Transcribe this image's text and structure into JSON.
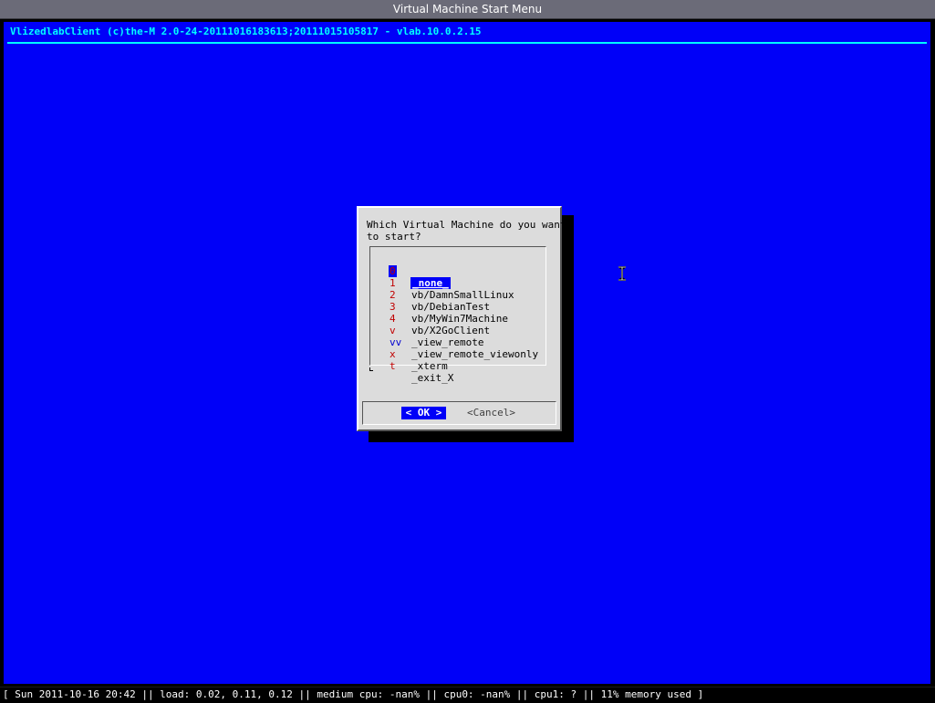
{
  "window": {
    "title": "Virtual Machine Start Menu"
  },
  "header": {
    "text": "VlizedlabClient (c)the-M 2.0-24-20111016183613;20111015105817 - vlab.10.0.2.15"
  },
  "dialog": {
    "prompt": "Which Virtual Machine do you want\nto start?",
    "items": [
      {
        "tag": "0",
        "label": "_none_"
      },
      {
        "tag": "1",
        "label": "vb/DamnSmallLinux"
      },
      {
        "tag": "2",
        "label": "vb/DebianTest"
      },
      {
        "tag": "3",
        "label": "vb/MyWin7Machine"
      },
      {
        "tag": "4",
        "label": "vb/X2GoClient"
      },
      {
        "tag": "v",
        "label": "_view_remote"
      },
      {
        "tag": "vv",
        "label": "_view_remote_viewonly"
      },
      {
        "tag": "x",
        "label": "_xterm"
      },
      {
        "tag": "t",
        "label": "_exit_X"
      }
    ],
    "selected_index": 0,
    "ok_label": "< OK >",
    "cancel_label": "<Cancel>"
  },
  "statusbar": {
    "text": "[ Sun 2011-10-16 20:42 || load: 0.02, 0.11, 0.12 || medium cpu: -nan% || cpu0: -nan% || cpu1: ? || 11% memory used ]"
  },
  "colors": {
    "screen_bg": "#0000f8",
    "header_text": "#00ffff",
    "dialog_bg": "#dcdcdc",
    "hotkey": "#c00000"
  }
}
